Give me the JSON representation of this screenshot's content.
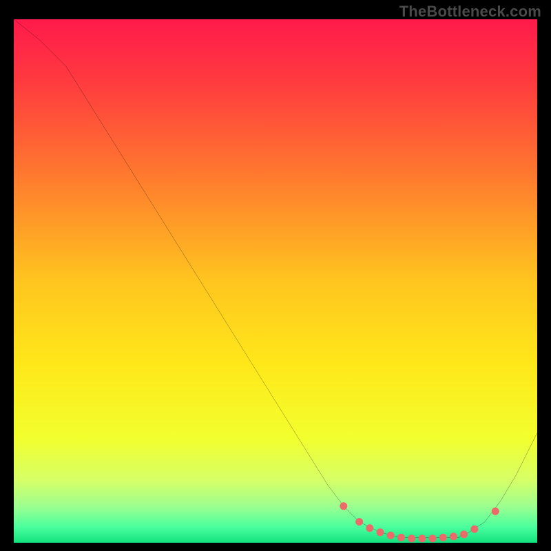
{
  "watermark": "TheBottleneck.com",
  "chart_data": {
    "type": "line",
    "title": "",
    "xlabel": "",
    "ylabel": "",
    "xlim": [
      0,
      100
    ],
    "ylim": [
      0,
      100
    ],
    "background_gradient": {
      "stops": [
        {
          "offset": 0.0,
          "color": "#ff1a4b"
        },
        {
          "offset": 0.12,
          "color": "#ff3b3f"
        },
        {
          "offset": 0.3,
          "color": "#ff7a2e"
        },
        {
          "offset": 0.5,
          "color": "#ffc51f"
        },
        {
          "offset": 0.66,
          "color": "#ffe81a"
        },
        {
          "offset": 0.8,
          "color": "#f2ff2e"
        },
        {
          "offset": 0.88,
          "color": "#d6ff66"
        },
        {
          "offset": 0.93,
          "color": "#9dff8f"
        },
        {
          "offset": 0.97,
          "color": "#4bff9e"
        },
        {
          "offset": 1.0,
          "color": "#12e27e"
        }
      ]
    },
    "series": [
      {
        "name": "curve",
        "color": "#000000",
        "width": 1.6,
        "x": [
          0,
          5,
          10,
          15,
          20,
          25,
          30,
          35,
          40,
          45,
          50,
          55,
          60,
          63,
          66,
          70,
          74,
          78,
          82,
          85,
          87,
          90,
          93,
          96,
          100
        ],
        "values": [
          100,
          96,
          91,
          83,
          75,
          67,
          59,
          51,
          43,
          35,
          27,
          19,
          11,
          7,
          4,
          2,
          1,
          1,
          1,
          1,
          2,
          4,
          8,
          13,
          21
        ]
      }
    ],
    "markers": {
      "name": "highlight-dots",
      "color": "#ec6a6a",
      "radius": 5.5,
      "x": [
        63,
        66,
        68,
        70,
        72,
        74,
        76,
        78,
        80,
        82,
        84,
        86,
        88,
        92
      ],
      "values": [
        7,
        4,
        2.8,
        2,
        1.4,
        1,
        0.8,
        0.8,
        0.8,
        1,
        1.2,
        1.6,
        2.6,
        6
      ]
    }
  }
}
